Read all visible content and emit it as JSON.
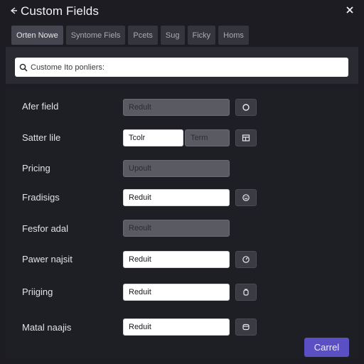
{
  "header": {
    "title": "Custom Fields",
    "back_icon": "arrow-left-icon",
    "close_icon": "close-icon"
  },
  "tabs": [
    {
      "label": "Orten Nowe",
      "active": true
    },
    {
      "label": "Syntome Fiels",
      "active": false
    },
    {
      "label": "Pcets",
      "active": false
    },
    {
      "label": "Sug",
      "active": false
    },
    {
      "label": "Ficky",
      "active": false
    },
    {
      "label": "Homs",
      "active": false
    }
  ],
  "search": {
    "placeholder": "Custome Ito ponliers:",
    "icon": "search-icon"
  },
  "rows": [
    {
      "label": "Afer field",
      "value": "Redult",
      "state": "disabled",
      "action_icon": "circle-icon"
    },
    {
      "label": "Satter lile",
      "value": "Tcolr",
      "secondary_value": "Term",
      "state": "enabled",
      "action_icon": "table-icon"
    },
    {
      "label": "Pricing",
      "value": "Upoult",
      "state": "disabled",
      "action_icon": null
    },
    {
      "label": "Fradisigs",
      "value": "Reduit",
      "state": "enabled",
      "action_icon": "smile-icon"
    },
    {
      "label": "Fesfor adal",
      "value": "Reoult",
      "state": "disabled",
      "action_icon": null
    },
    {
      "label": "Pawer najsit",
      "value": "Reduit",
      "state": "enabled",
      "action_icon": "gauge-icon"
    },
    {
      "label": "Priiging",
      "value": "Reduit",
      "state": "enabled",
      "action_icon": "lock-icon"
    },
    {
      "label": "Matal naajis",
      "value": "Reduit",
      "state": "enabled",
      "action_icon": "box-icon"
    }
  ],
  "footer": {
    "cancel_label": "Carrel"
  },
  "colors": {
    "background": "#1c1c22",
    "panel": "#1e1f25",
    "accent": "#5b4fc4",
    "disabled_field": "#5a5b62"
  }
}
